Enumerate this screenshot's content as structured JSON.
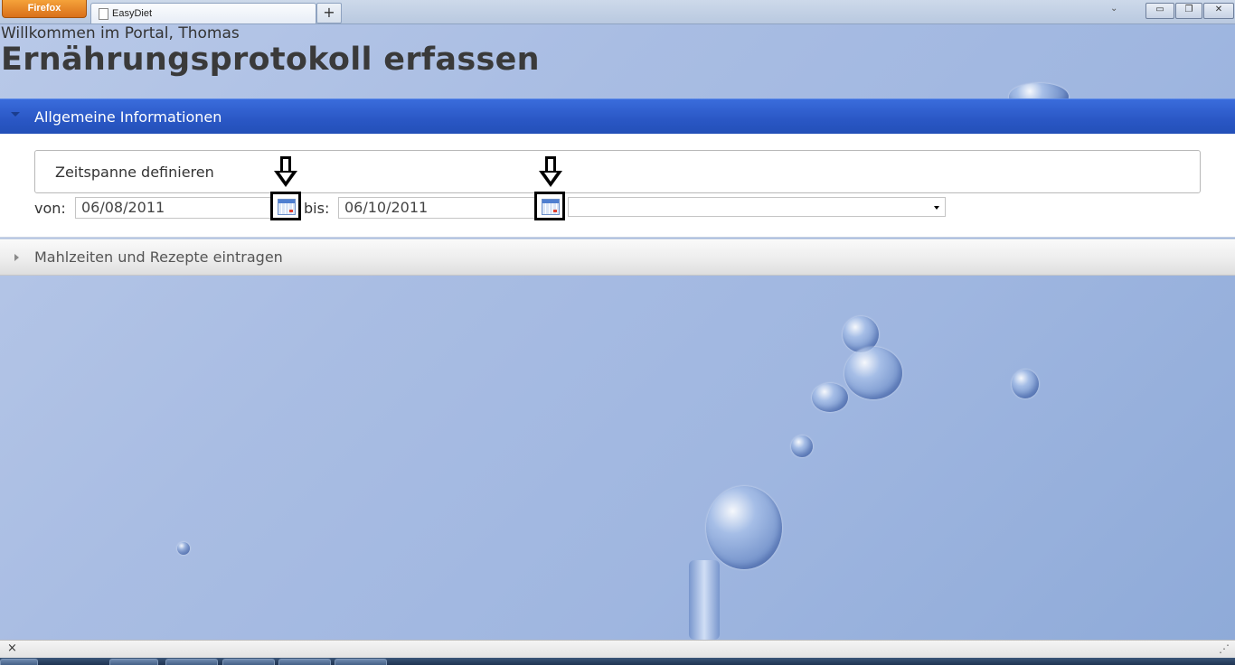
{
  "browser": {
    "menu_button": "Firefox",
    "tab_title": "EasyDiet",
    "new_tab_symbol": "+",
    "tab_list_symbol": "⌄",
    "minimize_symbol": "▭",
    "restore_symbol": "❐",
    "close_symbol": "✕"
  },
  "header": {
    "welcome": "Willkommen im Portal, Thomas",
    "title": "Ernährungsprotokoll erfassen"
  },
  "sections": {
    "general": {
      "label": "Allgemeine Informationen",
      "fieldset_legend": "Zeitspanne definieren",
      "from_label": "von:",
      "from_value": "06/08/2011",
      "to_label": "bis:",
      "to_value": "06/10/2011",
      "select_value": ""
    },
    "meals": {
      "label": "Mahlzeiten und Rezepte eintragen"
    }
  },
  "statusbar": {
    "close_symbol": "×",
    "resize_symbol": "⋰"
  },
  "colors": {
    "accordion_active": "#2a57c5",
    "highlight_border": "#000000"
  }
}
